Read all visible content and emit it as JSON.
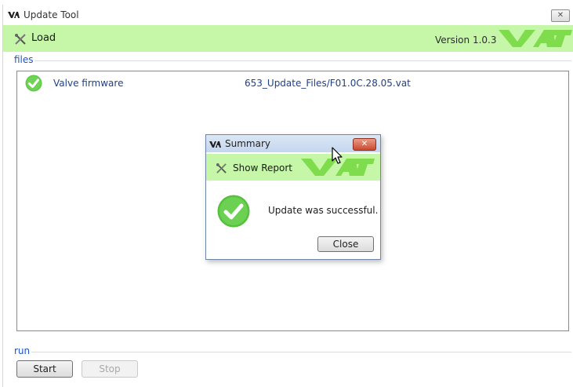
{
  "window": {
    "title": "Update Tool",
    "close_glyph": "✕"
  },
  "toolbar": {
    "load_label": "Load",
    "version": "Version 1.0.3"
  },
  "groups": {
    "files": "files",
    "run": "run"
  },
  "files": [
    {
      "name": "Valve firmware",
      "path": "653_Update_Files/F01.0C.28.05.vat",
      "status": "success"
    }
  ],
  "dialog": {
    "title": "Summary",
    "close_glyph": "✕",
    "show_report": "Show Report",
    "message": "Update was successful.",
    "close_label": "Close"
  },
  "run": {
    "start_label": "Start",
    "stop_label": "Stop",
    "stop_enabled": false
  },
  "colors": {
    "accent_green": "#c6f7a9",
    "logo_green": "#7fdc4c",
    "check_green": "#5fc94a",
    "link_blue": "#1f3f86"
  },
  "icons": [
    "vat-logo-icon",
    "tool-icon",
    "check-icon",
    "close-icon",
    "cursor-icon"
  ]
}
